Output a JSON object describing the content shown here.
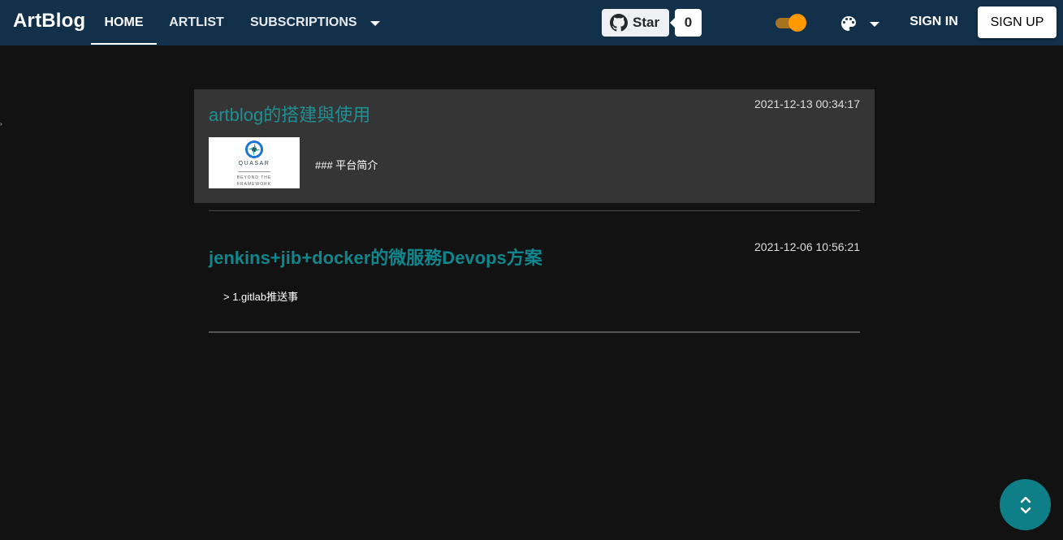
{
  "header": {
    "brand": "ArtBlog",
    "tabs": [
      {
        "label": "HOME",
        "active": true
      },
      {
        "label": "ARTLIST",
        "active": false
      },
      {
        "label": "SUBSCRIPTIONS",
        "active": false
      }
    ],
    "github": {
      "star_label": "Star",
      "star_count": "0"
    },
    "sign_in": "SIGN IN",
    "sign_up": "SIGN UP"
  },
  "posts": [
    {
      "title": "artblog的搭建與使用",
      "date": "2021-12-13 00:34:17",
      "excerpt": "### 平台简介",
      "thumbnail": {
        "brand": "QUASAR",
        "tagline": "BEYOND THE FRAMEWORK"
      }
    },
    {
      "title": "jenkins+jib+docker的微服務Devops方案",
      "date": "2021-12-06 10:56:21",
      "excerpt": "> 1.gitlab推送事"
    }
  ],
  "colors": {
    "header_bg": "#12304a",
    "page_bg": "#121212",
    "card_bg": "#353535",
    "title_link": "#1f8f94",
    "accent_toggle": "#ff9800",
    "fab": "#0e7f87"
  }
}
